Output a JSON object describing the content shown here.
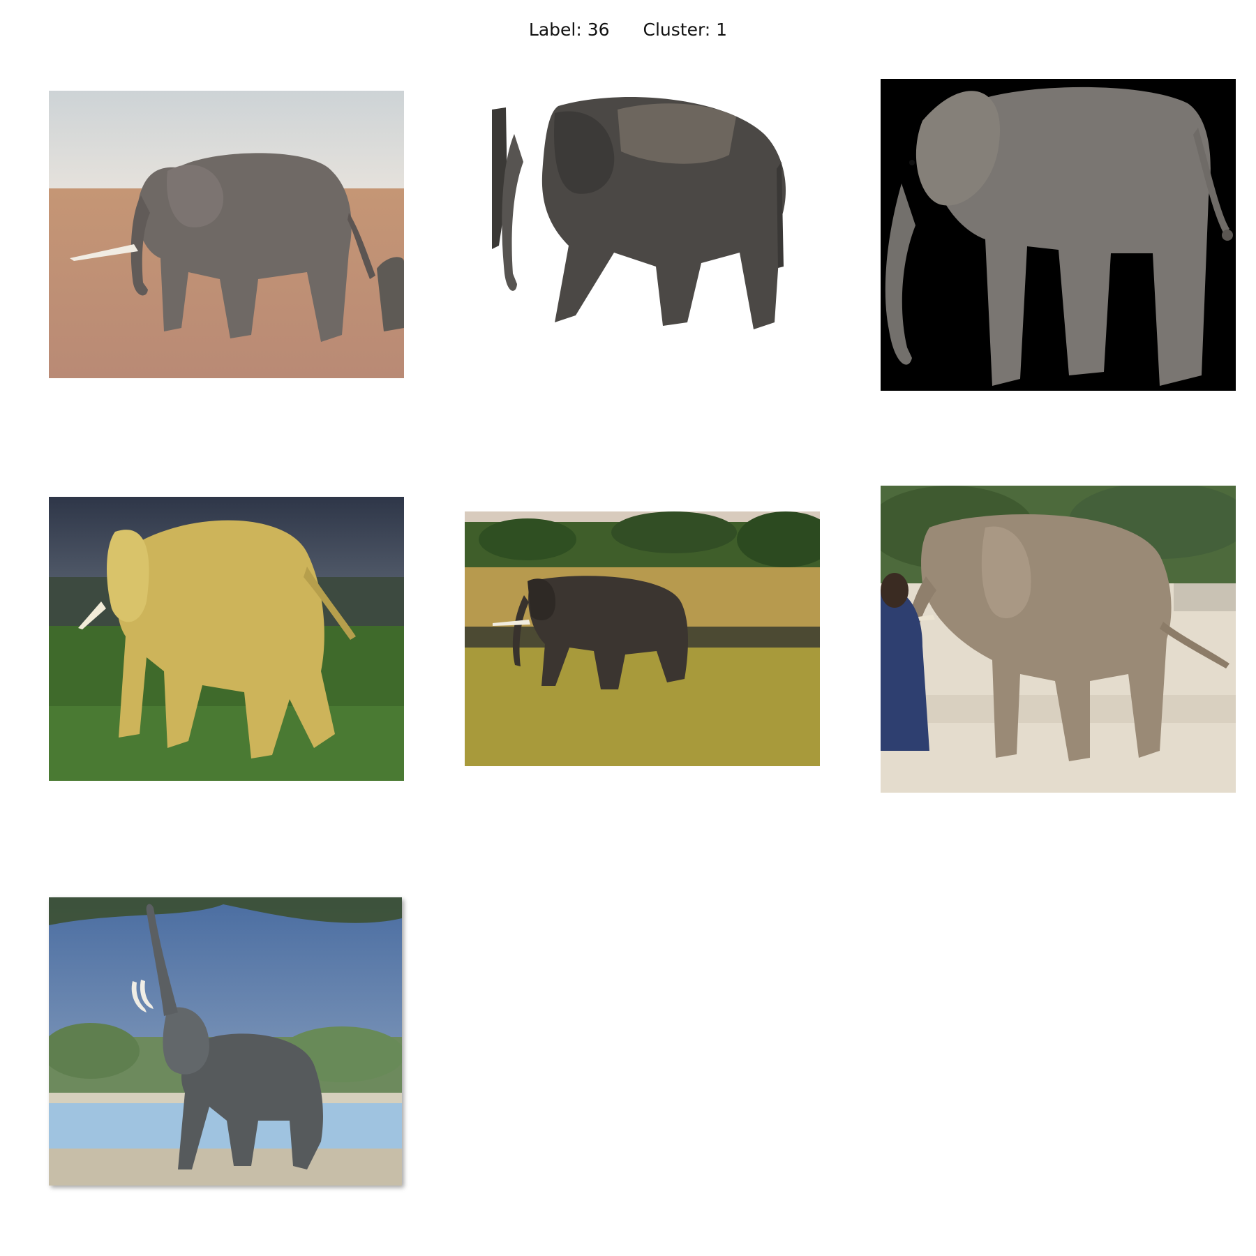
{
  "header": {
    "label_text": "Label: 36",
    "cluster_text": "Cluster: 1"
  },
  "images": [
    {
      "subject": "elephant",
      "scene": "dry savanna, elephant walking left"
    },
    {
      "subject": "elephant",
      "scene": "cut-out on white background"
    },
    {
      "subject": "elephant",
      "scene": "3D render on black background"
    },
    {
      "subject": "elephant",
      "scene": "golden light, rear view on grass"
    },
    {
      "subject": "elephant",
      "scene": "walking across grassland"
    },
    {
      "subject": "elephant",
      "scene": "zoo enclosure with visitors"
    },
    {
      "subject": "elephant",
      "scene": "trunk raised by river"
    }
  ],
  "colors": {
    "background": "#ffffff",
    "text": "#111111"
  }
}
